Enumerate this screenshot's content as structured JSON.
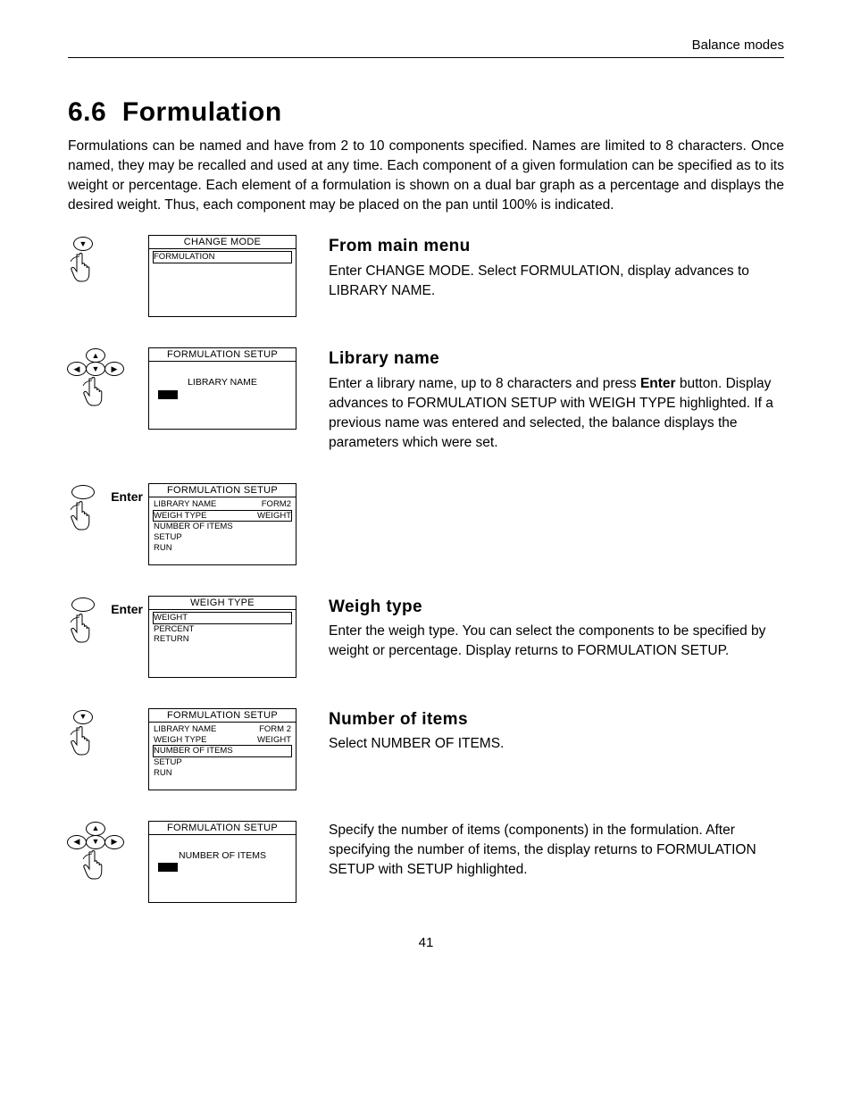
{
  "header": {
    "right": "Balance modes"
  },
  "section": {
    "number": "6.6",
    "title": "Formulation",
    "intro": "Formulations can be named and have from 2 to 10 components specified.  Names are limited to 8 characters.  Once named, they may be recalled and used at any time.  Each component of a given formulation can be specified as to its weight or percentage.  Each element of a formulation is shown on a dual bar graph as a percentage and displays the desired weight.  Thus, each component may be placed on the pan until 100% is indicated."
  },
  "steps": {
    "s1": {
      "heading": "From main menu",
      "body": "Enter CHANGE MODE.  Select FORMULATION, display advances to LIBRARY NAME.",
      "lcd_title": "CHANGE MODE",
      "lcd_line1": "FORMULATION"
    },
    "s2": {
      "heading": "Library name",
      "body_a": "Enter a library name, up to 8 characters and press ",
      "body_bold": "Enter",
      "body_b": " button.  Display advances to FORMULATION SETUP with WEIGH TYPE highlighted.  If a previous name was entered and selected, the balance displays the parameters which were set.",
      "lcd_title": "FORMULATION SETUP",
      "lcd_center": "LIBRARY NAME"
    },
    "s3": {
      "enter": "Enter",
      "lcd_title": "FORMULATION SETUP",
      "r1l": "LIBRARY NAME",
      "r1r": "FORM2",
      "r2l": "WEIGH TYPE",
      "r2r": "WEIGHT",
      "r3l": "NUMBER OF ITEMS",
      "r4l": "SETUP",
      "r5l": "RUN"
    },
    "s4": {
      "enter": "Enter",
      "heading": "Weigh type",
      "body": "Enter the weigh type. You can select the components to be specified by weight or percentage.  Display returns to FORMULATION SETUP.",
      "lcd_title": "WEIGH TYPE",
      "r1": "WEIGHT",
      "r2": "PERCENT",
      "r3": "RETURN"
    },
    "s5": {
      "heading": "Number of items",
      "body": "Select NUMBER OF ITEMS.",
      "lcd_title": "FORMULATION SETUP",
      "r1l": "LIBRARY NAME",
      "r1r": "FORM 2",
      "r2l": "WEIGH TYPE",
      "r2r": "WEIGHT",
      "r3l": "NUMBER OF ITEMS",
      "r4l": "SETUP",
      "r5l": "RUN"
    },
    "s6": {
      "body": "Specify the number of items (components) in the formulation.  After specifying the number of items, the display returns to FORMULATION SETUP with SETUP highlighted.",
      "lcd_title": "FORMULATION SETUP",
      "lcd_center": "NUMBER OF ITEMS"
    }
  },
  "page": "41"
}
